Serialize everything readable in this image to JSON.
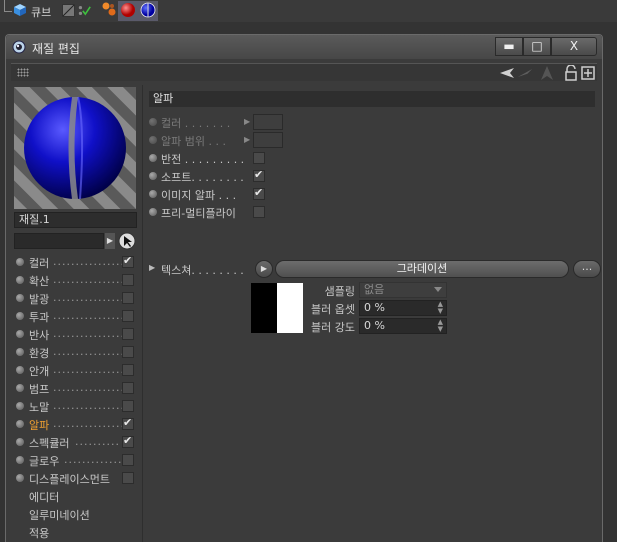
{
  "object_manager": {
    "object_name": "큐브"
  },
  "window": {
    "title": "재질 편집",
    "minimize_label": "▬",
    "maximize_label": "□",
    "close_label": "X"
  },
  "material": {
    "name": "재질.1",
    "search_value": ""
  },
  "channels": [
    {
      "label": "컬러",
      "checked": true,
      "active": false,
      "has_dot": true
    },
    {
      "label": "확산",
      "checked": false,
      "active": false,
      "has_dot": true
    },
    {
      "label": "발광",
      "checked": false,
      "active": false,
      "has_dot": true
    },
    {
      "label": "투과",
      "checked": false,
      "active": false,
      "has_dot": true
    },
    {
      "label": "반사",
      "checked": false,
      "active": false,
      "has_dot": true
    },
    {
      "label": "환경",
      "checked": false,
      "active": false,
      "has_dot": true
    },
    {
      "label": "안개",
      "checked": false,
      "active": false,
      "has_dot": true
    },
    {
      "label": "범프",
      "checked": false,
      "active": false,
      "has_dot": true
    },
    {
      "label": "노말",
      "checked": false,
      "active": false,
      "has_dot": true
    },
    {
      "label": "알파",
      "checked": true,
      "active": true,
      "has_dot": true
    },
    {
      "label": "스펙큘러",
      "checked": true,
      "active": false,
      "has_dot": true
    },
    {
      "label": "글로우",
      "checked": false,
      "active": false,
      "has_dot": true
    },
    {
      "label": "디스플레이스먼트",
      "checked": false,
      "active": false,
      "has_dot": true
    },
    {
      "label": "에디터",
      "checked": null,
      "active": false,
      "has_dot": false
    },
    {
      "label": "일루미네이션",
      "checked": null,
      "active": false,
      "has_dot": false
    },
    {
      "label": "적용",
      "checked": null,
      "active": false,
      "has_dot": false
    }
  ],
  "section": {
    "title": "알파",
    "props": [
      {
        "label": "컬러 . . . . . . .",
        "kind": "color",
        "dim": true
      },
      {
        "label": "알파 범위 . . .",
        "kind": "color",
        "dim": true
      },
      {
        "label": "반전 . . . . . . . . .",
        "kind": "checkbox",
        "checked": false,
        "dim": false
      },
      {
        "label": "소프트. . . . . . . .",
        "kind": "checkbox",
        "checked": true,
        "dim": false
      },
      {
        "label": "이미지 알파 . . .",
        "kind": "checkbox",
        "checked": true,
        "dim": false
      },
      {
        "label": "프리-멀티플라이",
        "kind": "checkbox",
        "checked": false,
        "dim": false
      }
    ],
    "texture": {
      "label": "텍스쳐. . . . . . . .",
      "name": "그라데이션",
      "more": "..."
    },
    "sub_props": [
      {
        "label": "샘플링",
        "value": "없음",
        "kind": "dropdown"
      },
      {
        "label": "블러 옵셋",
        "value": "0 %",
        "kind": "spinner"
      },
      {
        "label": "블러 강도",
        "value": "0 %",
        "kind": "spinner"
      }
    ]
  },
  "colors": {
    "accent_active_channel": "#f0a030",
    "sphere_blue": "#1010c8",
    "stripe_light": "#8a8a8a",
    "stripe_dark": "#5a5a5a"
  }
}
